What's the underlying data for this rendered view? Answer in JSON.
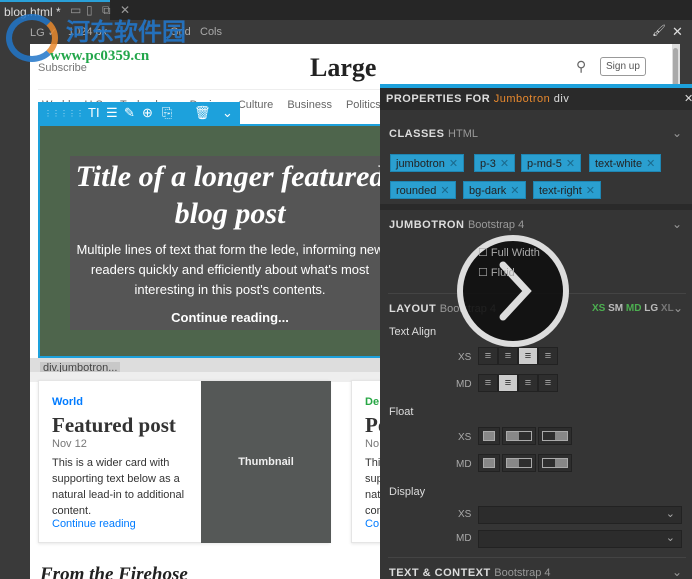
{
  "window": {
    "tab_title": "blog.html *"
  },
  "toolbar": {
    "breakpoint": "LG",
    "width": "1024 px",
    "grid": "Grid",
    "cols": "Cols"
  },
  "site": {
    "subscribe": "Subscribe",
    "brand": "Large",
    "signup": "Sign up",
    "nav": [
      "World",
      "U.S.",
      "Technology",
      "Design",
      "Culture",
      "Business",
      "Politics"
    ]
  },
  "jumbotron": {
    "title": "Title of a longer featured blog post",
    "lede": "Multiple lines of text that form the lede, informing new readers quickly and efficiently about what's most interesting in this post's contents.",
    "link": "Continue reading...",
    "element_label": "div.jumbotron..."
  },
  "cards": [
    {
      "category": "World",
      "title": "Featured post",
      "date": "Nov 12",
      "text": "This is a wider card with supporting text below as a natural lead-in to additional content.",
      "link": "Continue reading",
      "thumb": "Thumbnail",
      "category_color": "#007bff"
    },
    {
      "category": "De",
      "title": "Po",
      "date": "No",
      "text": "Thi sup nat con",
      "link": "Co",
      "category_color": "#28a745"
    }
  ],
  "firehose": "From the Firehose",
  "panel": {
    "title_prefix": "PROPERTIES FOR",
    "element": "Jumbotron",
    "title_suffix": "div",
    "classes": {
      "title": "CLASSES",
      "sub": "HTML",
      "tags": [
        "jumbotron",
        "p-3",
        "p-md-5",
        "text-white",
        "rounded",
        "bg-dark",
        "text-right"
      ]
    },
    "jumbotron": {
      "title": "JUMBOTRON",
      "sub": "Bootstrap 4",
      "full_width": "Full Width",
      "fluid": "Fluid"
    },
    "layout": {
      "title": "LAYOUT",
      "sub": "Bootstrap 4",
      "breakpoints": [
        "XS",
        "SM",
        "MD",
        "LG",
        "XL"
      ],
      "active_breakpoints": [
        "XS",
        "MD"
      ],
      "text_align": "Text Align",
      "float": "Float",
      "display": "Display",
      "xs": "XS",
      "md": "MD",
      "xs_align": "right",
      "md_align": "center"
    },
    "text_context": {
      "title": "TEXT & CONTEXT",
      "sub": "Bootstrap 4"
    }
  },
  "watermark": {
    "cn": "河东软件园",
    "url": "www.pc0359.cn"
  },
  "colors": {
    "accent": "#1da1dc",
    "highlight": "#e8892e",
    "active_bp": "#4caf50"
  }
}
